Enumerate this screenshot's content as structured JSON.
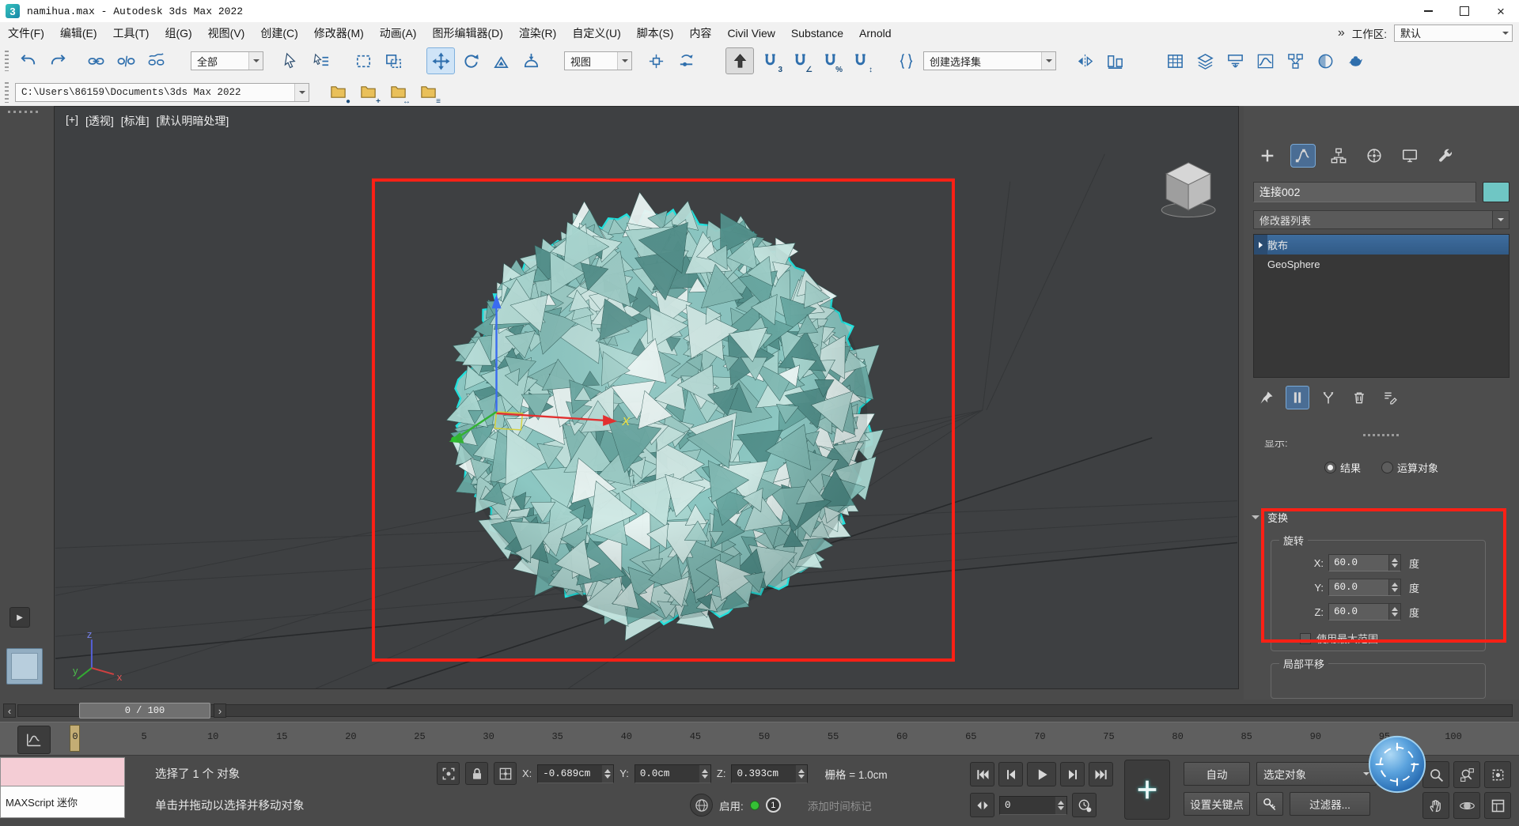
{
  "window": {
    "logo_letter": "3",
    "title": "namihua.max - Autodesk 3ds Max 2022"
  },
  "menu": {
    "items": [
      "文件(F)",
      "编辑(E)",
      "工具(T)",
      "组(G)",
      "视图(V)",
      "创建(C)",
      "修改器(M)",
      "动画(A)",
      "图形编辑器(D)",
      "渲染(R)",
      "自定义(U)",
      "脚本(S)",
      "内容",
      "Civil View",
      "Substance",
      "Arnold"
    ],
    "overflow": "»",
    "workspace_label": "工作区:",
    "workspace_value": "默认"
  },
  "toolbar": {
    "selection_filter_value": "全部",
    "reference_coordsys_value": "视图",
    "named_selection_value": "创建选择集"
  },
  "project_bar": {
    "folder_path": "C:\\Users\\86159\\Documents\\3ds Max 2022"
  },
  "viewport": {
    "label_general": "[+]",
    "label_pov": "[透视]",
    "label_standard": "[标准]",
    "label_shading": "[默认明暗处理]",
    "axis_x": "x",
    "axis_y": "y",
    "axis_z": "z",
    "gizmo_axis_label": "X",
    "object_outline_color": "#23e0dc"
  },
  "command_panel": {
    "object_name": "连接002",
    "object_color": "#6fc6c4",
    "modifier_list_label": "修改器列表",
    "stack": [
      {
        "label": "散布",
        "selected": true
      },
      {
        "label": "GeoSphere",
        "selected": false
      }
    ],
    "display_label": "显示:",
    "display_radios": [
      {
        "label": "结果",
        "selected": true
      },
      {
        "label": "运算对象",
        "selected": false
      }
    ],
    "transform_rollout_title": "变换",
    "rotation_group_title": "旋转",
    "rotation_rows": [
      {
        "axis": "X:",
        "value": "60.0",
        "unit": "度"
      },
      {
        "axis": "Y:",
        "value": "60.0",
        "unit": "度"
      },
      {
        "axis": "Z:",
        "value": "60.0",
        "unit": "度"
      }
    ],
    "use_max_range_label": "使用最大范围",
    "local_translation_title": "局部平移"
  },
  "timeline": {
    "slider_label": "0 / 100",
    "ticks": [
      "0",
      "5",
      "10",
      "15",
      "20",
      "25",
      "30",
      "35",
      "40",
      "45",
      "50",
      "55",
      "60",
      "65",
      "70",
      "75",
      "80",
      "85",
      "90",
      "95",
      "100"
    ]
  },
  "status_bar": {
    "listener_text": "MAXScript 迷你",
    "selection_status": "选择了 1 个 对象",
    "prompt": "单击并拖动以选择并移动对象",
    "x_label": "X:",
    "x_value": "-0.689cm",
    "y_label": "Y:",
    "y_value": "0.0cm",
    "z_label": "Z:",
    "z_value": "0.393cm",
    "grid_info": "栅格 = 1.0cm",
    "enable_label": "启用:",
    "enable_badge": "1",
    "time_tag_label": "添加时间标记",
    "time_field_value": "0",
    "auto_key_label": "自动",
    "set_key_label": "设置关键点",
    "key_filter_value": "选定对象",
    "filters_label": "过滤器..."
  },
  "annotations": {
    "highlight_color": "#ff2015"
  }
}
